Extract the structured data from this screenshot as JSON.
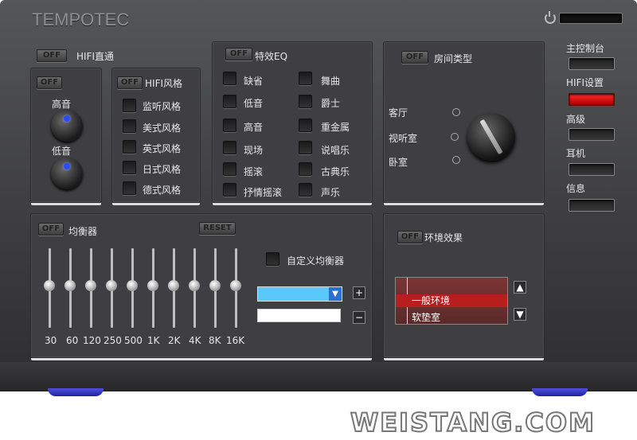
{
  "brand": "TEMPOTEC",
  "off_label": "OFF",
  "reset_label": "RESET",
  "hifi_direct": {
    "title": "HIFI直通",
    "treble": "高音",
    "bass": "低音"
  },
  "hifi_style": {
    "title": "HIFI风格",
    "items": [
      "监听风格",
      "美式风格",
      "英式风格",
      "日式风格",
      "德式风格"
    ]
  },
  "effect_eq": {
    "title": "特效EQ",
    "left": [
      "缺省",
      "低音",
      "高音",
      "现场",
      "摇滚",
      "抒情摇滚"
    ],
    "right": [
      "舞曲",
      "爵士",
      "重金属",
      "说唱乐",
      "古典乐",
      "声乐"
    ]
  },
  "room": {
    "title": "房间类型",
    "options": [
      "客厅",
      "视听室",
      "卧室"
    ]
  },
  "equalizer": {
    "title": "均衡器",
    "custom": "自定义均衡器",
    "bands": [
      "30",
      "60",
      "120",
      "250",
      "500",
      "1K",
      "2K",
      "4K",
      "8K",
      "16K"
    ],
    "plus": "+",
    "minus": "−"
  },
  "environment": {
    "title": "环境效果",
    "items": [
      "一般环境",
      "软垫室"
    ]
  },
  "side": {
    "items": [
      "主控制台",
      "HIFI设置",
      "高级",
      "耳机",
      "信息"
    ],
    "active_index": 1
  },
  "watermark": "WEISTANG.COM"
}
